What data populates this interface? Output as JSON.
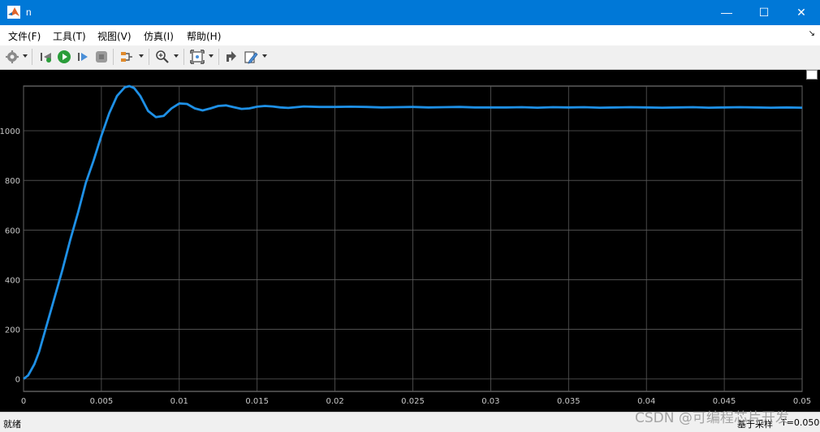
{
  "window": {
    "title": "n",
    "minimize": "—",
    "maximize": "☐",
    "close": "✕"
  },
  "menu": {
    "items": [
      "文件(F)",
      "工具(T)",
      "视图(V)",
      "仿真(I)",
      "帮助(H)"
    ]
  },
  "toolbar": {
    "icons": [
      "gear-icon",
      "step-back-icon",
      "run-icon",
      "step-forward-icon",
      "stop-icon",
      "signal-select-icon",
      "zoom-icon",
      "autoscale-icon",
      "highlight-icon",
      "edit-icon"
    ]
  },
  "status": {
    "left": "就绪",
    "mode": "基于采样",
    "time": "T=0.050"
  },
  "watermark": "CSDN @可编程芯片开发",
  "colors": {
    "accent": "#0078d7",
    "trace": "#1e90e6",
    "plot_bg": "#000000",
    "grid": "#5a5a5a",
    "axis_text": "#c8c8c8"
  },
  "chart_data": {
    "type": "line",
    "title": "",
    "xlabel": "",
    "ylabel": "",
    "xlim": [
      0,
      0.05
    ],
    "ylim": [
      -50,
      1180
    ],
    "xticks": [
      0,
      0.005,
      0.01,
      0.015,
      0.02,
      0.025,
      0.03,
      0.035,
      0.04,
      0.045,
      0.05
    ],
    "xtick_labels": [
      "0",
      "0.005",
      "0.01",
      "0.015",
      "0.02",
      "0.025",
      "0.03",
      "0.035",
      "0.04",
      "0.045",
      "0.05"
    ],
    "yticks": [
      0,
      200,
      400,
      600,
      800,
      1000
    ],
    "ytick_labels": [
      "0",
      "200",
      "400",
      "600",
      "800",
      "1000"
    ],
    "grid": true,
    "legend": "none",
    "series": [
      {
        "x": [
          0,
          0.0003,
          0.0007,
          0.001,
          0.0015,
          0.002,
          0.0025,
          0.003,
          0.0035,
          0.004,
          0.0045,
          0.005,
          0.0055,
          0.006,
          0.0065,
          0.0068,
          0.0071,
          0.0075,
          0.008,
          0.0085,
          0.009,
          0.0095,
          0.01,
          0.0105,
          0.011,
          0.0115,
          0.012,
          0.0125,
          0.013,
          0.0135,
          0.014,
          0.0145,
          0.015,
          0.0155,
          0.016,
          0.0165,
          0.017,
          0.0175,
          0.018,
          0.019,
          0.02,
          0.021,
          0.022,
          0.023,
          0.024,
          0.025,
          0.026,
          0.027,
          0.028,
          0.029,
          0.03,
          0.031,
          0.032,
          0.033,
          0.034,
          0.035,
          0.036,
          0.037,
          0.038,
          0.039,
          0.04,
          0.041,
          0.042,
          0.043,
          0.044,
          0.045,
          0.046,
          0.047,
          0.048,
          0.049,
          0.05
        ],
        "y": [
          0,
          15,
          60,
          110,
          220,
          330,
          440,
          560,
          670,
          790,
          880,
          980,
          1070,
          1140,
          1175,
          1180,
          1172,
          1140,
          1080,
          1055,
          1060,
          1090,
          1110,
          1108,
          1090,
          1082,
          1090,
          1100,
          1102,
          1095,
          1088,
          1090,
          1097,
          1100,
          1098,
          1094,
          1092,
          1095,
          1098,
          1096,
          1096,
          1097,
          1096,
          1094,
          1095,
          1096,
          1094,
          1095,
          1096,
          1094,
          1094,
          1094,
          1095,
          1093,
          1095,
          1094,
          1095,
          1093,
          1094,
          1095,
          1094,
          1093,
          1094,
          1095,
          1093,
          1094,
          1095,
          1094,
          1093,
          1094,
          1093
        ]
      }
    ]
  }
}
